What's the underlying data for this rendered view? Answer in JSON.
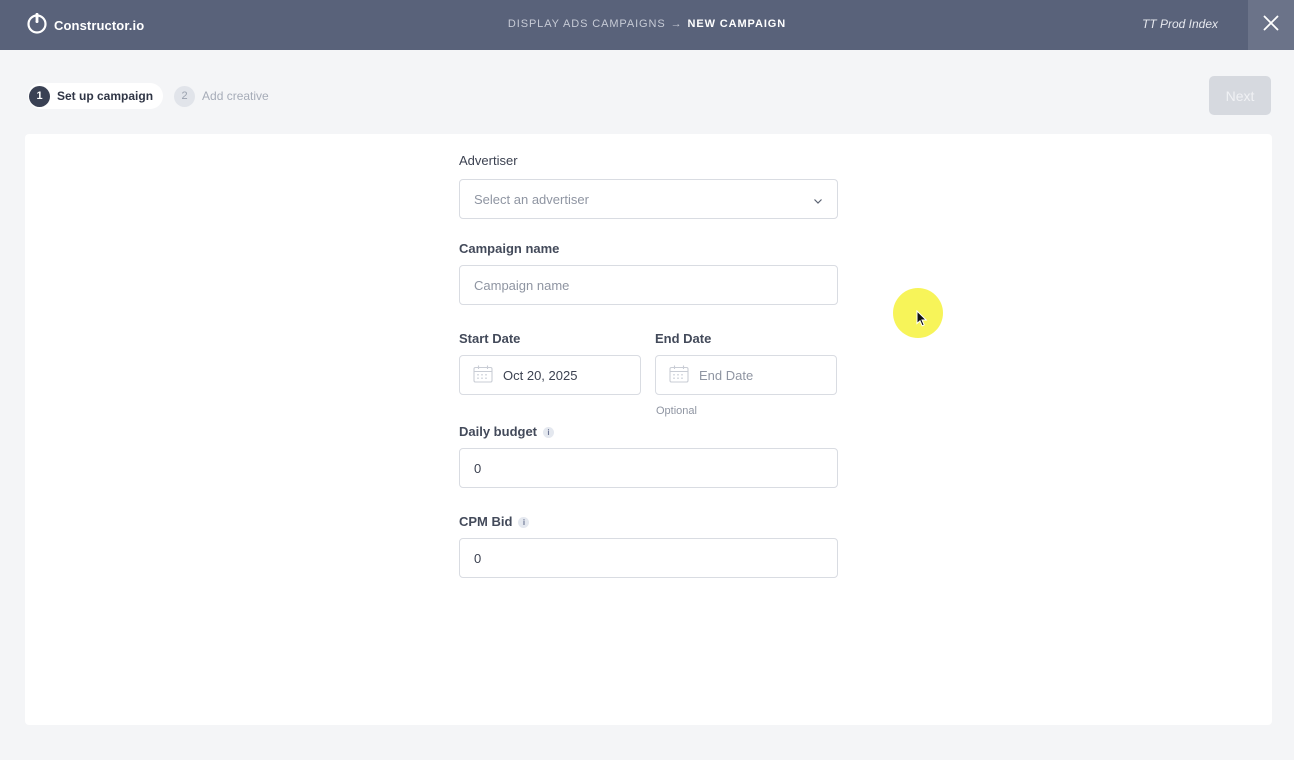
{
  "header": {
    "brand": "Constructor.io",
    "breadcrumb_prev": "DISPLAY ADS CAMPAIGNS",
    "breadcrumb_arrow": "→",
    "breadcrumb_current": "NEW CAMPAIGN",
    "index_name": "TT Prod Index",
    "close_icon": "close-icon"
  },
  "stepper": {
    "steps": [
      {
        "num": "1",
        "label": "Set up campaign",
        "state": "active"
      },
      {
        "num": "2",
        "label": "Add creative",
        "state": "inactive"
      }
    ]
  },
  "actions": {
    "next_label": "Next"
  },
  "form": {
    "advertiser": {
      "label": "Advertiser",
      "placeholder": "Select an advertiser"
    },
    "campaign_name": {
      "label": "Campaign name",
      "placeholder": "Campaign name"
    },
    "start_date": {
      "label": "Start Date",
      "value": "Oct 20, 2025"
    },
    "end_date": {
      "label": "End Date",
      "placeholder": "End Date",
      "hint": "Optional"
    },
    "daily_budget": {
      "label": "Daily budget",
      "value": "0"
    },
    "cpm_bid": {
      "label": "CPM Bid",
      "value": "0"
    },
    "info_glyph": "i"
  },
  "colors": {
    "header_bg": "#59627a",
    "page_bg": "#f4f5f7",
    "accent_dark": "#3a4154",
    "next_disabled": "#d6d9df",
    "cursor_highlight": "#f6f23c"
  }
}
